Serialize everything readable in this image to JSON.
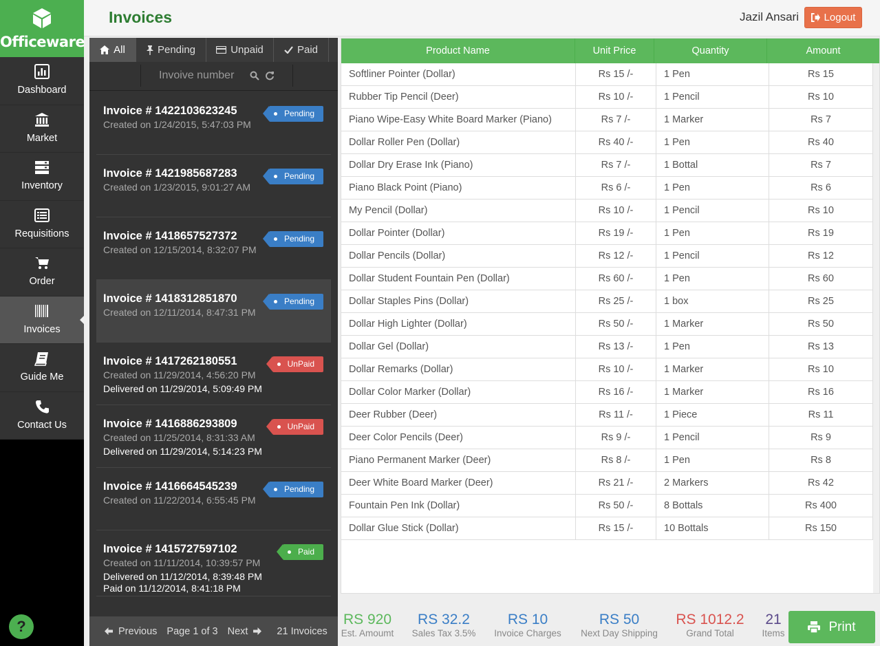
{
  "app": {
    "name": "Officeware"
  },
  "sidebar": {
    "items": [
      {
        "label": "Dashboard",
        "icon": "bar-chart-icon"
      },
      {
        "label": "Market",
        "icon": "bank-icon"
      },
      {
        "label": "Inventory",
        "icon": "server-icon"
      },
      {
        "label": "Requisitions",
        "icon": "list-icon"
      },
      {
        "label": "Order",
        "icon": "cart-icon"
      },
      {
        "label": "Invoices",
        "icon": "barcode-icon",
        "active": true
      },
      {
        "label": "Guide Me",
        "icon": "book-icon"
      },
      {
        "label": "Contact Us",
        "icon": "phone-icon"
      }
    ],
    "help": "?"
  },
  "header": {
    "title": "Invoices",
    "user": "Jazil Ansari",
    "logout": "Logout"
  },
  "filters": {
    "all": "All",
    "pending": "Pending",
    "unpaid": "Unpaid",
    "paid": "Paid"
  },
  "search": {
    "placeholder": "Invoive number"
  },
  "invoices": [
    {
      "number": "Invoice # 1422103623245",
      "created": "Created on 1/24/2015, 5:47:03 PM",
      "status": "Pending"
    },
    {
      "number": "Invoice # 1421985687283",
      "created": "Created on 1/23/2015, 9:01:27 AM",
      "status": "Pending"
    },
    {
      "number": "Invoice # 1418657527372",
      "created": "Created on 12/15/2014, 8:32:07 PM",
      "status": "Pending"
    },
    {
      "number": "Invoice # 1418312851870",
      "created": "Created on 12/11/2014, 8:47:31 PM",
      "status": "Pending"
    },
    {
      "number": "Invoice # 1417262180551",
      "created": "Created on 11/29/2014, 4:56:20 PM",
      "delivered": "Delivered on 11/29/2014, 5:09:49 PM",
      "status": "UnPaid"
    },
    {
      "number": "Invoice # 1416886293809",
      "created": "Created on 11/25/2014, 8:31:33 AM",
      "delivered": "Delivered on 11/29/2014, 5:14:23 PM",
      "status": "UnPaid"
    },
    {
      "number": "Invoice # 1416664545239",
      "created": "Created on 11/22/2014, 6:55:45 PM",
      "status": "Pending"
    },
    {
      "number": "Invoice # 1415727597102",
      "created": "Created on 11/11/2014, 10:39:57 PM",
      "delivered": "Delivered on 11/12/2014, 8:39:48 PM",
      "paid": "Paid on 11/12/2014, 8:41:18 PM",
      "status": "Paid"
    }
  ],
  "pager": {
    "previous": "Previous",
    "page": "Page 1 of 3",
    "next": "Next",
    "count": "21 Invoices"
  },
  "table": {
    "headers": {
      "product": "Product Name",
      "unit_price": "Unit Price",
      "quantity": "Quantity",
      "amount": "Amount"
    },
    "rows": [
      [
        "Softliner Pointer (Dollar)",
        "Rs 15 /-",
        "1 Pen",
        "Rs 15"
      ],
      [
        "Rubber Tip Pencil (Deer)",
        "Rs 10 /-",
        "1 Pencil",
        "Rs 10"
      ],
      [
        "Piano Wipe-Easy White Board Marker (Piano)",
        "Rs 7 /-",
        "1 Marker",
        "Rs 7"
      ],
      [
        "Dollar Roller Pen (Dollar)",
        "Rs 40 /-",
        "1 Pen",
        "Rs 40"
      ],
      [
        "Dollar Dry Erase Ink (Piano)",
        "Rs 7 /-",
        "1 Bottal",
        "Rs 7"
      ],
      [
        "Piano Black Point (Piano)",
        "Rs 6 /-",
        "1 Pen",
        "Rs 6"
      ],
      [
        "My Pencil (Dollar)",
        "Rs 10 /-",
        "1 Pencil",
        "Rs 10"
      ],
      [
        "Dollar Pointer (Dollar)",
        "Rs 19 /-",
        "1 Pen",
        "Rs 19"
      ],
      [
        "Dollar Pencils (Dollar)",
        "Rs 12 /-",
        "1 Pencil",
        "Rs 12"
      ],
      [
        "Dollar Student Fountain Pen (Dollar)",
        "Rs 60 /-",
        "1 Pen",
        "Rs 60"
      ],
      [
        "Dollar Staples Pins (Dollar)",
        "Rs 25 /-",
        "1 box",
        "Rs 25"
      ],
      [
        "Dollar High Lighter (Dollar)",
        "Rs 50 /-",
        "1 Marker",
        "Rs 50"
      ],
      [
        "Dollar Gel (Dollar)",
        "Rs 13 /-",
        "1 Pen",
        "Rs 13"
      ],
      [
        "Dollar Remarks (Dollar)",
        "Rs 10 /-",
        "1 Marker",
        "Rs 10"
      ],
      [
        "Dollar Color Marker (Dollar)",
        "Rs 16 /-",
        "1 Marker",
        "Rs 16"
      ],
      [
        "Deer Rubber (Deer)",
        "Rs 11 /-",
        "1 Piece",
        "Rs 11"
      ],
      [
        "Deer Color Pencils (Deer)",
        "Rs 9 /-",
        "1 Pencil",
        "Rs 9"
      ],
      [
        "Piano Permanent Marker (Deer)",
        "Rs 8 /-",
        "1 Pen",
        "Rs 8"
      ],
      [
        "Deer White Board Marker (Deer)",
        "Rs 21 /-",
        "2 Markers",
        "Rs 42"
      ],
      [
        "Fountain Pen Ink (Dollar)",
        "Rs 50 /-",
        "8 Bottals",
        "Rs 400"
      ],
      [
        "Dollar Glue Stick (Dollar)",
        "Rs 15 /-",
        "10 Bottals",
        "Rs 150"
      ]
    ]
  },
  "totals": {
    "est_amount": {
      "value": "RS 920",
      "label": "Est. Amoumt",
      "color": "#5cb85c"
    },
    "sales_tax": {
      "value": "RS 32.2",
      "label": "Sales Tax 3.5%",
      "color": "#3a7ec6"
    },
    "invoice_charges": {
      "value": "RS 10",
      "label": "Invoice Charges",
      "color": "#3a7ec6"
    },
    "shipping": {
      "value": "RS 50",
      "label": "Next Day Shipping",
      "color": "#3a7ec6"
    },
    "grand_total": {
      "value": "RS 1012.2",
      "label": "Grand Total",
      "color": "#d9534f"
    },
    "items": {
      "value": "21",
      "label": "Items",
      "color": "#5b4a8a"
    }
  },
  "print": {
    "label": "Print"
  }
}
